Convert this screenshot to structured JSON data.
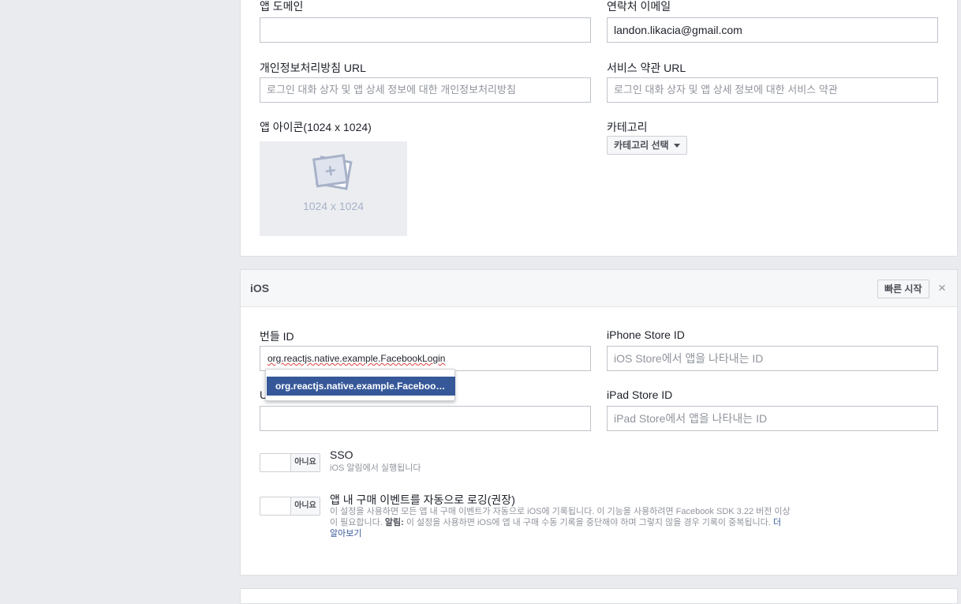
{
  "basic": {
    "app_domain_label": "앱 도메인",
    "app_domain_value": "",
    "contact_email_label": "연락처 이메일",
    "contact_email_value": "landon.likacia@gmail.com",
    "privacy_url_label": "개인정보처리방침 URL",
    "privacy_url_placeholder": "로그인 대화 상자 및 앱 상세 정보에 대한 개인정보처리방침",
    "terms_url_label": "서비스 약관 URL",
    "terms_url_placeholder": "로그인 대화 상자 및 앱 상세 정보에 대한 서비스 약관",
    "app_icon_label": "앱 아이콘(1024 x 1024)",
    "app_icon_size": "1024 x 1024",
    "category_label": "카테고리",
    "category_button": "카테고리 선택"
  },
  "ios": {
    "title": "iOS",
    "quick_start": "빠른 시작",
    "close_symbol": "×",
    "bundle_id_label": "번들 ID",
    "bundle_id_value": "org.reactjs.native.example.FacebookLogin",
    "autocomplete_item": "org.reactjs.native.example.Faceboo…",
    "url_suffix_label_visible": "U",
    "url_suffix_value": "",
    "iphone_store_label": "iPhone Store ID",
    "iphone_store_placeholder": "iOS Store에서 앱을 나타내는 ID",
    "ipad_store_label": "iPad Store ID",
    "ipad_store_placeholder": "iPad Store에서 앱을 나타내는 ID",
    "sso": {
      "toggle_label": "아니요",
      "title": "SSO",
      "desc": "iOS 알림에서 실행됩니다"
    },
    "iap": {
      "toggle_label": "아니요",
      "title": "앱 내 구매 이벤트를 자동으로 로깅(권장)",
      "desc_1": "이 설정을 사용하면 모든 앱 내 구매 이벤트가 자동으로 iOS에 기록됩니다. 이 기능을 사용하려면 Facebook SDK 3.22 버전 이상이 필요합니다. ",
      "desc_bold": "알림:",
      "desc_2": " 이 설정을 사용하면 iOS에 앱 내 구매 수동 기록을 중단해야 하며 그렇지 않을 경우 기록이 중복됩니다. ",
      "learn_more": "더 알아보기"
    }
  }
}
